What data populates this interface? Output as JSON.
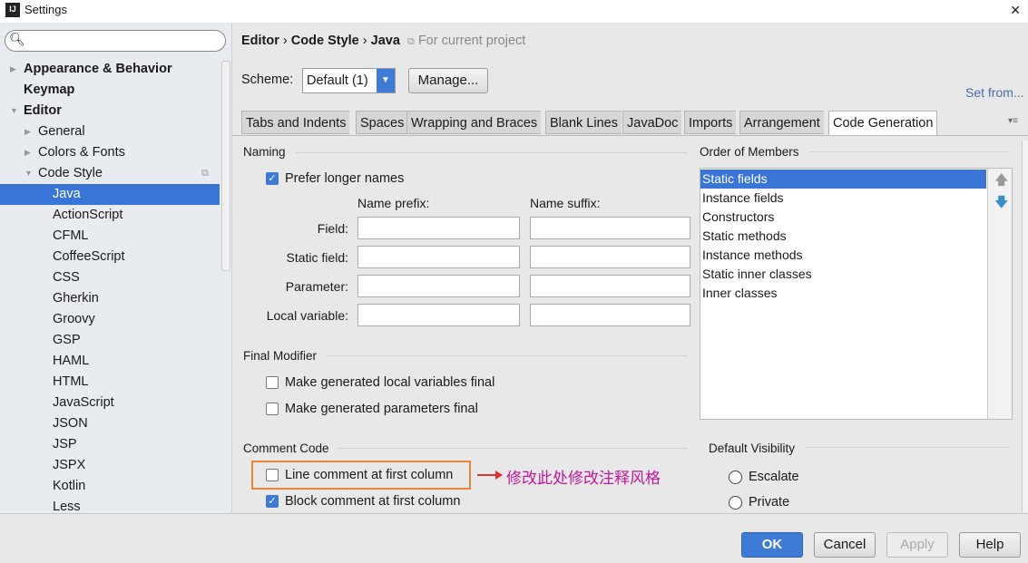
{
  "window": {
    "title": "Settings",
    "close": "✕"
  },
  "sidebar": {
    "search_placeholder": "",
    "items": [
      {
        "label": "Appearance & Behavior",
        "level": 0,
        "bold": true,
        "arrow": "right"
      },
      {
        "label": "Keymap",
        "level": 0,
        "bold": true,
        "arrow": ""
      },
      {
        "label": "Editor",
        "level": 0,
        "bold": true,
        "arrow": "down"
      },
      {
        "label": "General",
        "level": 1,
        "arrow": "right"
      },
      {
        "label": "Colors & Fonts",
        "level": 1,
        "arrow": "right"
      },
      {
        "label": "Code Style",
        "level": 1,
        "arrow": "down",
        "project_icon": true
      },
      {
        "label": "Java",
        "level": 2,
        "selected": true
      },
      {
        "label": "ActionScript",
        "level": 2
      },
      {
        "label": "CFML",
        "level": 2
      },
      {
        "label": "CoffeeScript",
        "level": 2
      },
      {
        "label": "CSS",
        "level": 2
      },
      {
        "label": "Gherkin",
        "level": 2
      },
      {
        "label": "Groovy",
        "level": 2
      },
      {
        "label": "GSP",
        "level": 2
      },
      {
        "label": "HAML",
        "level": 2
      },
      {
        "label": "HTML",
        "level": 2
      },
      {
        "label": "JavaScript",
        "level": 2
      },
      {
        "label": "JSON",
        "level": 2
      },
      {
        "label": "JSP",
        "level": 2
      },
      {
        "label": "JSPX",
        "level": 2
      },
      {
        "label": "Kotlin",
        "level": 2
      },
      {
        "label": "Less",
        "level": 2
      }
    ]
  },
  "breadcrumb": {
    "parts": [
      "Editor",
      "Code Style",
      "Java"
    ],
    "sep": "›",
    "scope": "For current project"
  },
  "scheme": {
    "label": "Scheme:",
    "value": "Default (1)",
    "manage": "Manage...",
    "set_from": "Set from..."
  },
  "tabs": [
    {
      "label": "Tabs and Indents"
    },
    {
      "label": "Spaces"
    },
    {
      "label": "Wrapping and Braces"
    },
    {
      "label": "Blank Lines"
    },
    {
      "label": "JavaDoc"
    },
    {
      "label": "Imports"
    },
    {
      "label": "Arrangement"
    },
    {
      "label": "Code Generation",
      "active": true
    }
  ],
  "naming": {
    "title": "Naming",
    "prefer_longer": "Prefer longer names",
    "prefix_header": "Name prefix:",
    "suffix_header": "Name suffix:",
    "rows": [
      {
        "label": "Field:",
        "prefix": "",
        "suffix": ""
      },
      {
        "label": "Static field:",
        "prefix": "",
        "suffix": ""
      },
      {
        "label": "Parameter:",
        "prefix": "",
        "suffix": ""
      },
      {
        "label": "Local variable:",
        "prefix": "",
        "suffix": ""
      }
    ]
  },
  "final_modifier": {
    "title": "Final Modifier",
    "items": [
      {
        "label": "Make generated local variables final",
        "checked": false
      },
      {
        "label": "Make generated parameters final",
        "checked": false
      }
    ]
  },
  "comment_code": {
    "title": "Comment Code",
    "items": [
      {
        "label": "Line comment at first column",
        "checked": false
      },
      {
        "label": "Block comment at first column",
        "checked": true
      }
    ]
  },
  "annotation": {
    "text": "修改此处修改注释风格",
    "color": "#c0189a",
    "box_color": "#e8853a",
    "arrow_color": "#e03030"
  },
  "order_of_members": {
    "title": "Order of Members",
    "items": [
      "Static fields",
      "Instance fields",
      "Constructors",
      "Static methods",
      "Instance methods",
      "Static inner classes",
      "Inner classes"
    ],
    "selected": 0
  },
  "default_visibility": {
    "title": "Default Visibility",
    "options": [
      "Escalate",
      "Private"
    ]
  },
  "footer": {
    "ok": "OK",
    "cancel": "Cancel",
    "apply": "Apply",
    "help": "Help"
  },
  "colors": {
    "accent": "#3875d7"
  }
}
